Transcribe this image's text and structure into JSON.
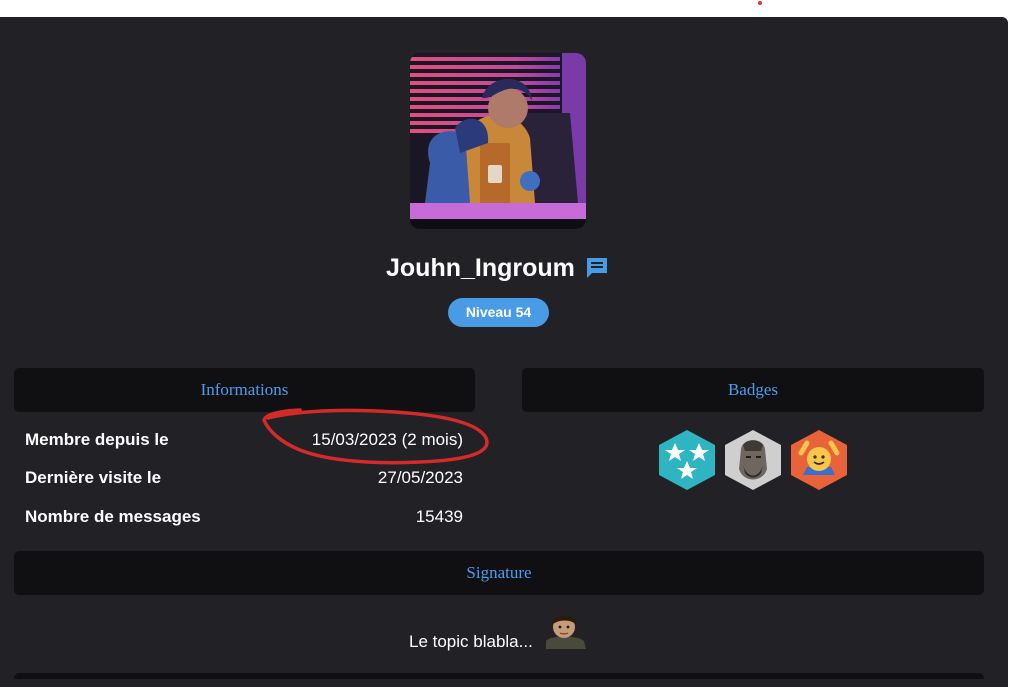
{
  "profile": {
    "username": "Jouhn_Ingroum",
    "level_label": "Niveau 54"
  },
  "informations": {
    "heading": "Informations",
    "rows": [
      {
        "label": "Membre depuis le",
        "value": "15/03/2023 (2 mois)"
      },
      {
        "label": "Dernière visite le",
        "value": "27/05/2023"
      },
      {
        "label": "Nombre de messages",
        "value": "15439"
      }
    ]
  },
  "badges": {
    "heading": "Badges"
  },
  "signature": {
    "heading": "Signature",
    "text": "Le topic blabla..."
  },
  "colors": {
    "card_bg": "#212126",
    "section_bg": "#101013",
    "accent_blue": "#4a9be6",
    "annotation_red": "#d42a2a"
  }
}
